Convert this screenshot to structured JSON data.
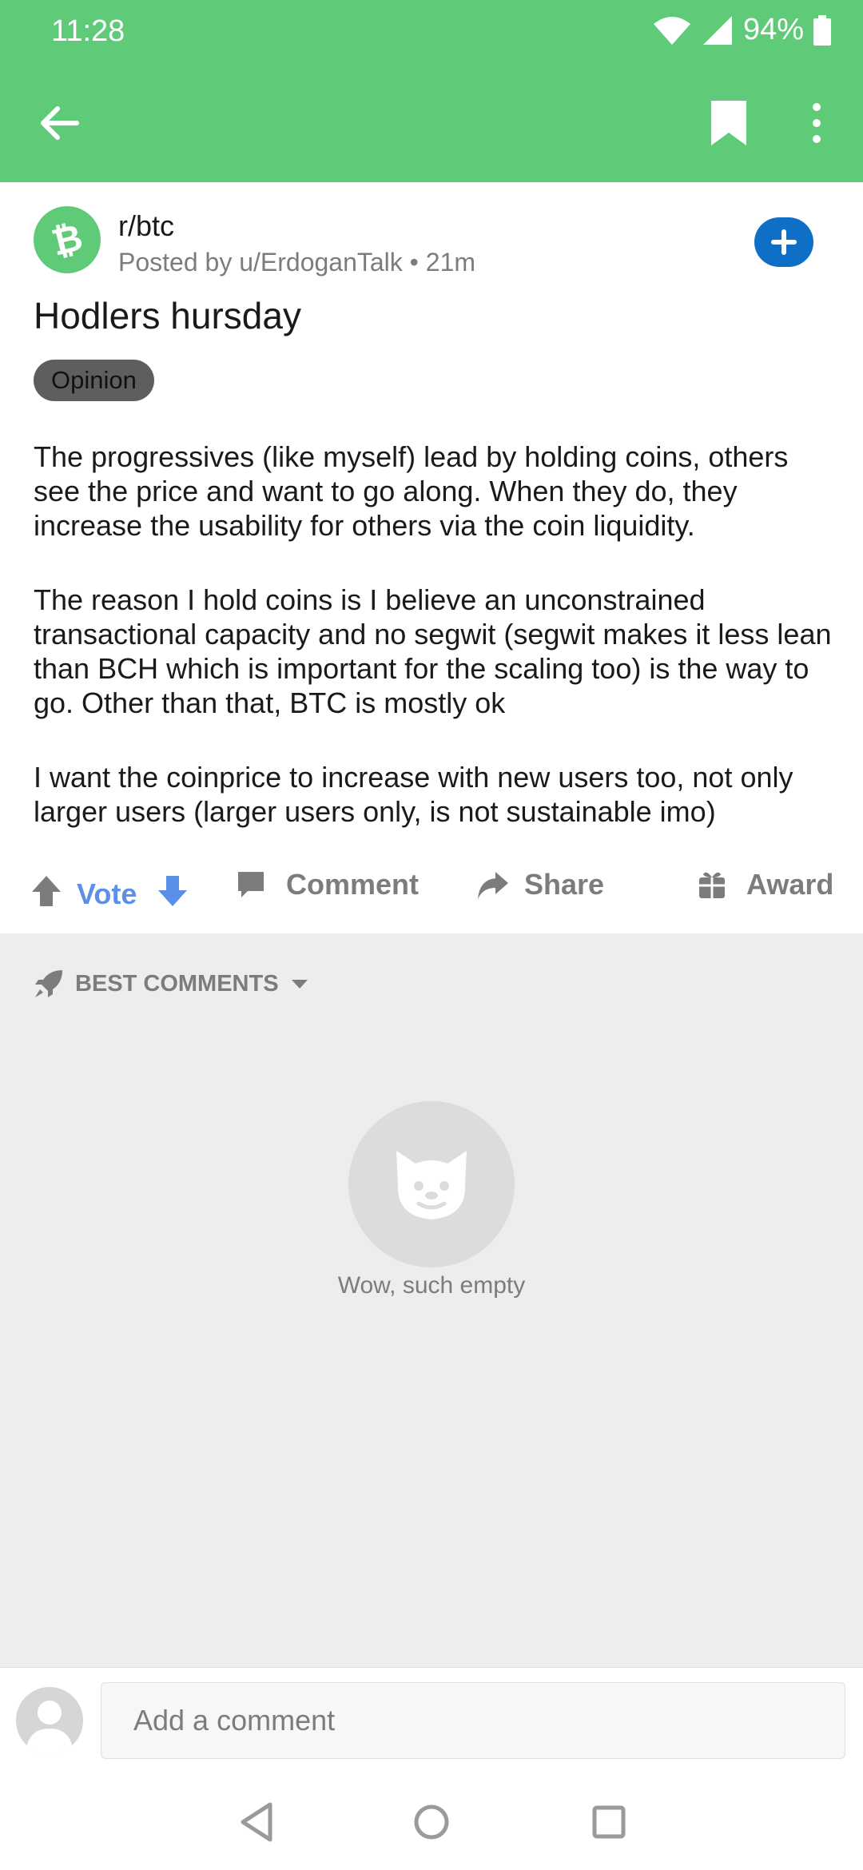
{
  "status_bar": {
    "time": "11:28",
    "battery": "94%"
  },
  "app_bar": {
    "icons": [
      "back-arrow-icon",
      "bookmark-icon",
      "more-vert-icon"
    ]
  },
  "post": {
    "subreddit": "r/btc",
    "posted_by": "Posted by u/ErdoganTalk • 21m",
    "title": "Hodlers hursday",
    "flair": "Opinion",
    "body": [
      "The progressives (like myself) lead by holding coins, others see the price and want to go along. When they do, they increase the usability for others via the coin liquidity.",
      "The reason I hold coins is I believe an unconstrained transactional capacity and no segwit (segwit makes it less lean than BCH which is important for the scaling too) is the way to go. Other than that, BTC is mostly ok",
      "I want the coinprice to increase with new users too, not only larger users (larger users only, is not sustainable imo)"
    ],
    "colors": {
      "brand": "#5fcb78",
      "join": "#0f6fc6",
      "vote": "#5c8fe8"
    }
  },
  "actions": {
    "vote": "Vote",
    "comment": "Comment",
    "share": "Share",
    "award": "Award"
  },
  "comments": {
    "sort_label": "BEST COMMENTS",
    "empty_text": "Wow, such empty"
  },
  "comment_bar": {
    "placeholder": "Add a comment"
  }
}
